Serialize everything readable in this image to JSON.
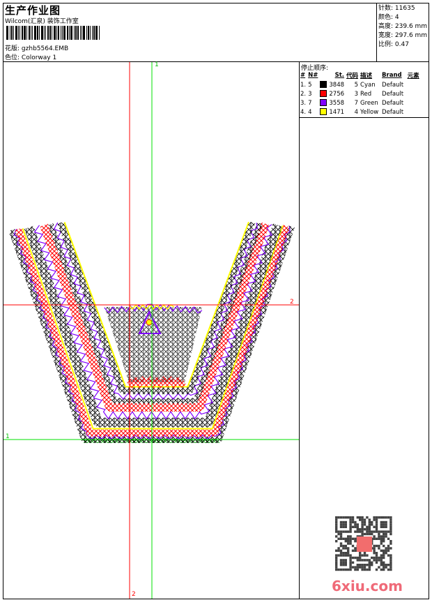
{
  "header": {
    "title": "生产作业图",
    "company": "Wilcom(汇泉) 装饰工作室",
    "design_label": "花版:",
    "design_value": "gzhb5564.EMB",
    "colorway_label": "色位:",
    "colorway_value": "Colorway 1"
  },
  "stats": [
    {
      "label": "针数:",
      "value": "11635"
    },
    {
      "label": "颜色:",
      "value": "4"
    },
    {
      "label": "高度:",
      "value": "239.6 mm"
    },
    {
      "label": "宽度:",
      "value": "297.6 mm"
    },
    {
      "label": "比例:",
      "value": "0.47"
    }
  ],
  "stop_sequence": {
    "title": "停止顺序:",
    "headers": [
      "#",
      "N#",
      "",
      "St.",
      "代码",
      "描述",
      "Brand",
      "元素"
    ],
    "rows": [
      {
        "idx": "1.",
        "n": "5",
        "color": "#000000",
        "st": "3848",
        "code": "5",
        "desc": "Cyan",
        "brand": "Default"
      },
      {
        "idx": "2.",
        "n": "3",
        "color": "#ff0000",
        "st": "2756",
        "code": "3",
        "desc": "Red",
        "brand": "Default"
      },
      {
        "idx": "3.",
        "n": "7",
        "color": "#8000ff",
        "st": "3558",
        "code": "7",
        "desc": "Green",
        "brand": "Default"
      },
      {
        "idx": "4.",
        "n": "4",
        "color": "#ffff00",
        "st": "1471",
        "code": "4",
        "desc": "Yellow",
        "brand": "Default"
      }
    ]
  },
  "guides": {
    "v1": "1",
    "h2": "2",
    "h1": "1",
    "v2": "2",
    "green": "#00e000",
    "red": "#ff0000"
  },
  "watermark": {
    "logo": "6xiu.com",
    "seal": "汉服图版"
  }
}
